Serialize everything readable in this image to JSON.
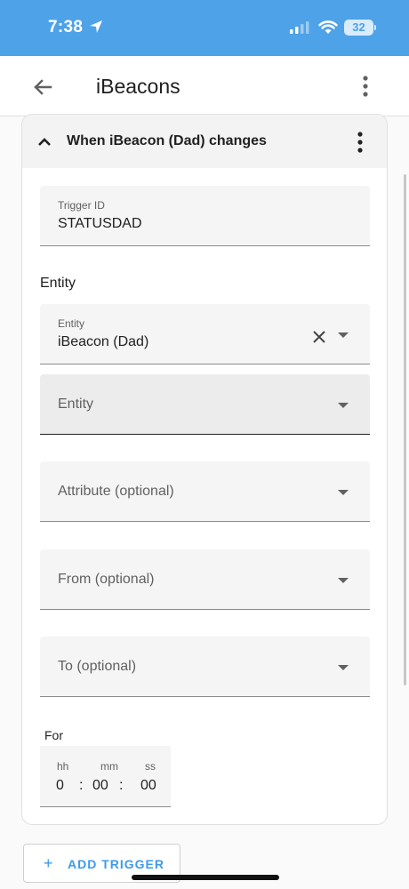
{
  "status_bar": {
    "time": "7:38",
    "battery": "32"
  },
  "app_bar": {
    "title": "iBeacons"
  },
  "card": {
    "title": "When iBeacon (Dad) changes",
    "trigger_id": {
      "label": "Trigger ID",
      "value": "STATUSDAD"
    },
    "entity_section_label": "Entity",
    "entity_selected": {
      "label": "Entity",
      "value": "iBeacon (Dad)"
    },
    "entity_picker": {
      "placeholder": "Entity"
    },
    "attribute": {
      "placeholder": "Attribute (optional)"
    },
    "from": {
      "placeholder": "From (optional)"
    },
    "to": {
      "placeholder": "To (optional)"
    },
    "for": {
      "label": "For",
      "units": {
        "hours": "hh",
        "minutes": "mm",
        "seconds": "ss"
      },
      "values": {
        "hours": "0",
        "minutes": "00",
        "seconds": "00"
      },
      "separator": ":"
    }
  },
  "add_trigger": {
    "label": "ADD TRIGGER",
    "icon": "plus-icon"
  },
  "colors": {
    "status_bar": "#4ea2e8",
    "accent": "#3d9be9"
  }
}
